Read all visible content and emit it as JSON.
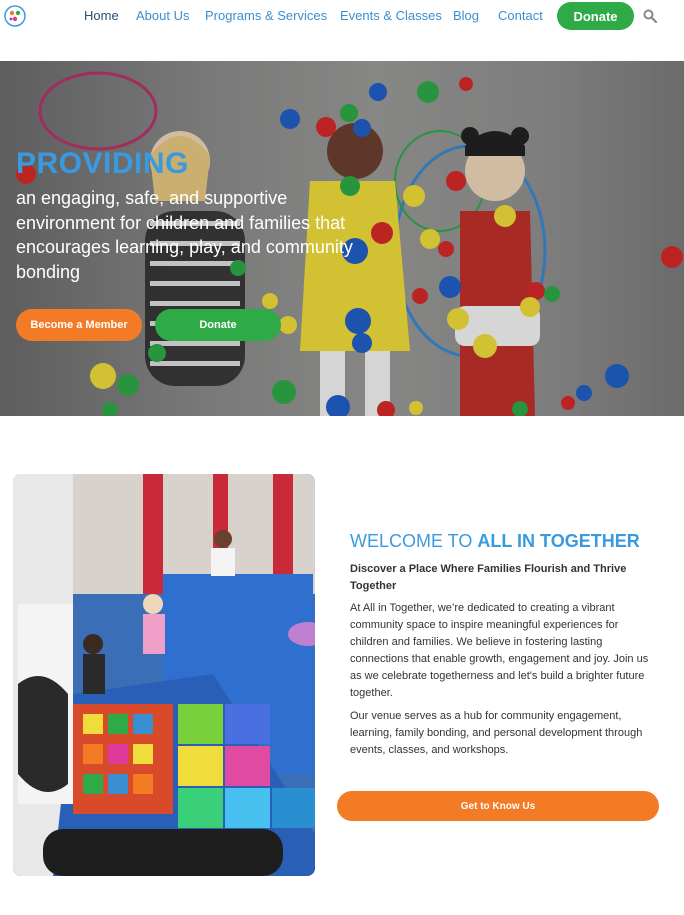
{
  "nav": {
    "links": [
      "Home",
      "About Us",
      "Programs & Services",
      "Events & Classes",
      "Blog",
      "Contact"
    ],
    "donate_label": "Donate",
    "icons": {
      "logo": "logo-icon",
      "search": "search-icon"
    }
  },
  "hero": {
    "title": "PROVIDING",
    "subtitle": "an engaging, safe, and supportive environment for children and families that encourages learning, play, and community bonding",
    "member_button": "Become a Member",
    "donate_button": "Donate"
  },
  "welcome": {
    "heading_prefix": "WELCOME TO ",
    "heading_strong": "ALL IN TOGETHER",
    "subheading": "Discover a Place Where Families Flourish and Thrive Together",
    "paragraph1": "At All in Together, we’re dedicated to creating a vibrant community space to inspire meaningful experiences for children and families. We believe in fostering lasting connections that enable growth, engagement and joy. Join us as we celebrate togetherness and let's build a brighter future together.",
    "paragraph2": "Our venue serves as a hub for community engagement, learning, family bonding, and personal development through events, classes, and workshops.",
    "button": "Get to Know Us"
  },
  "colors": {
    "accent_blue": "#3a9ae0",
    "nav_home": "#2a4f72",
    "green": "#2eaa47",
    "orange": "#f47b25"
  }
}
